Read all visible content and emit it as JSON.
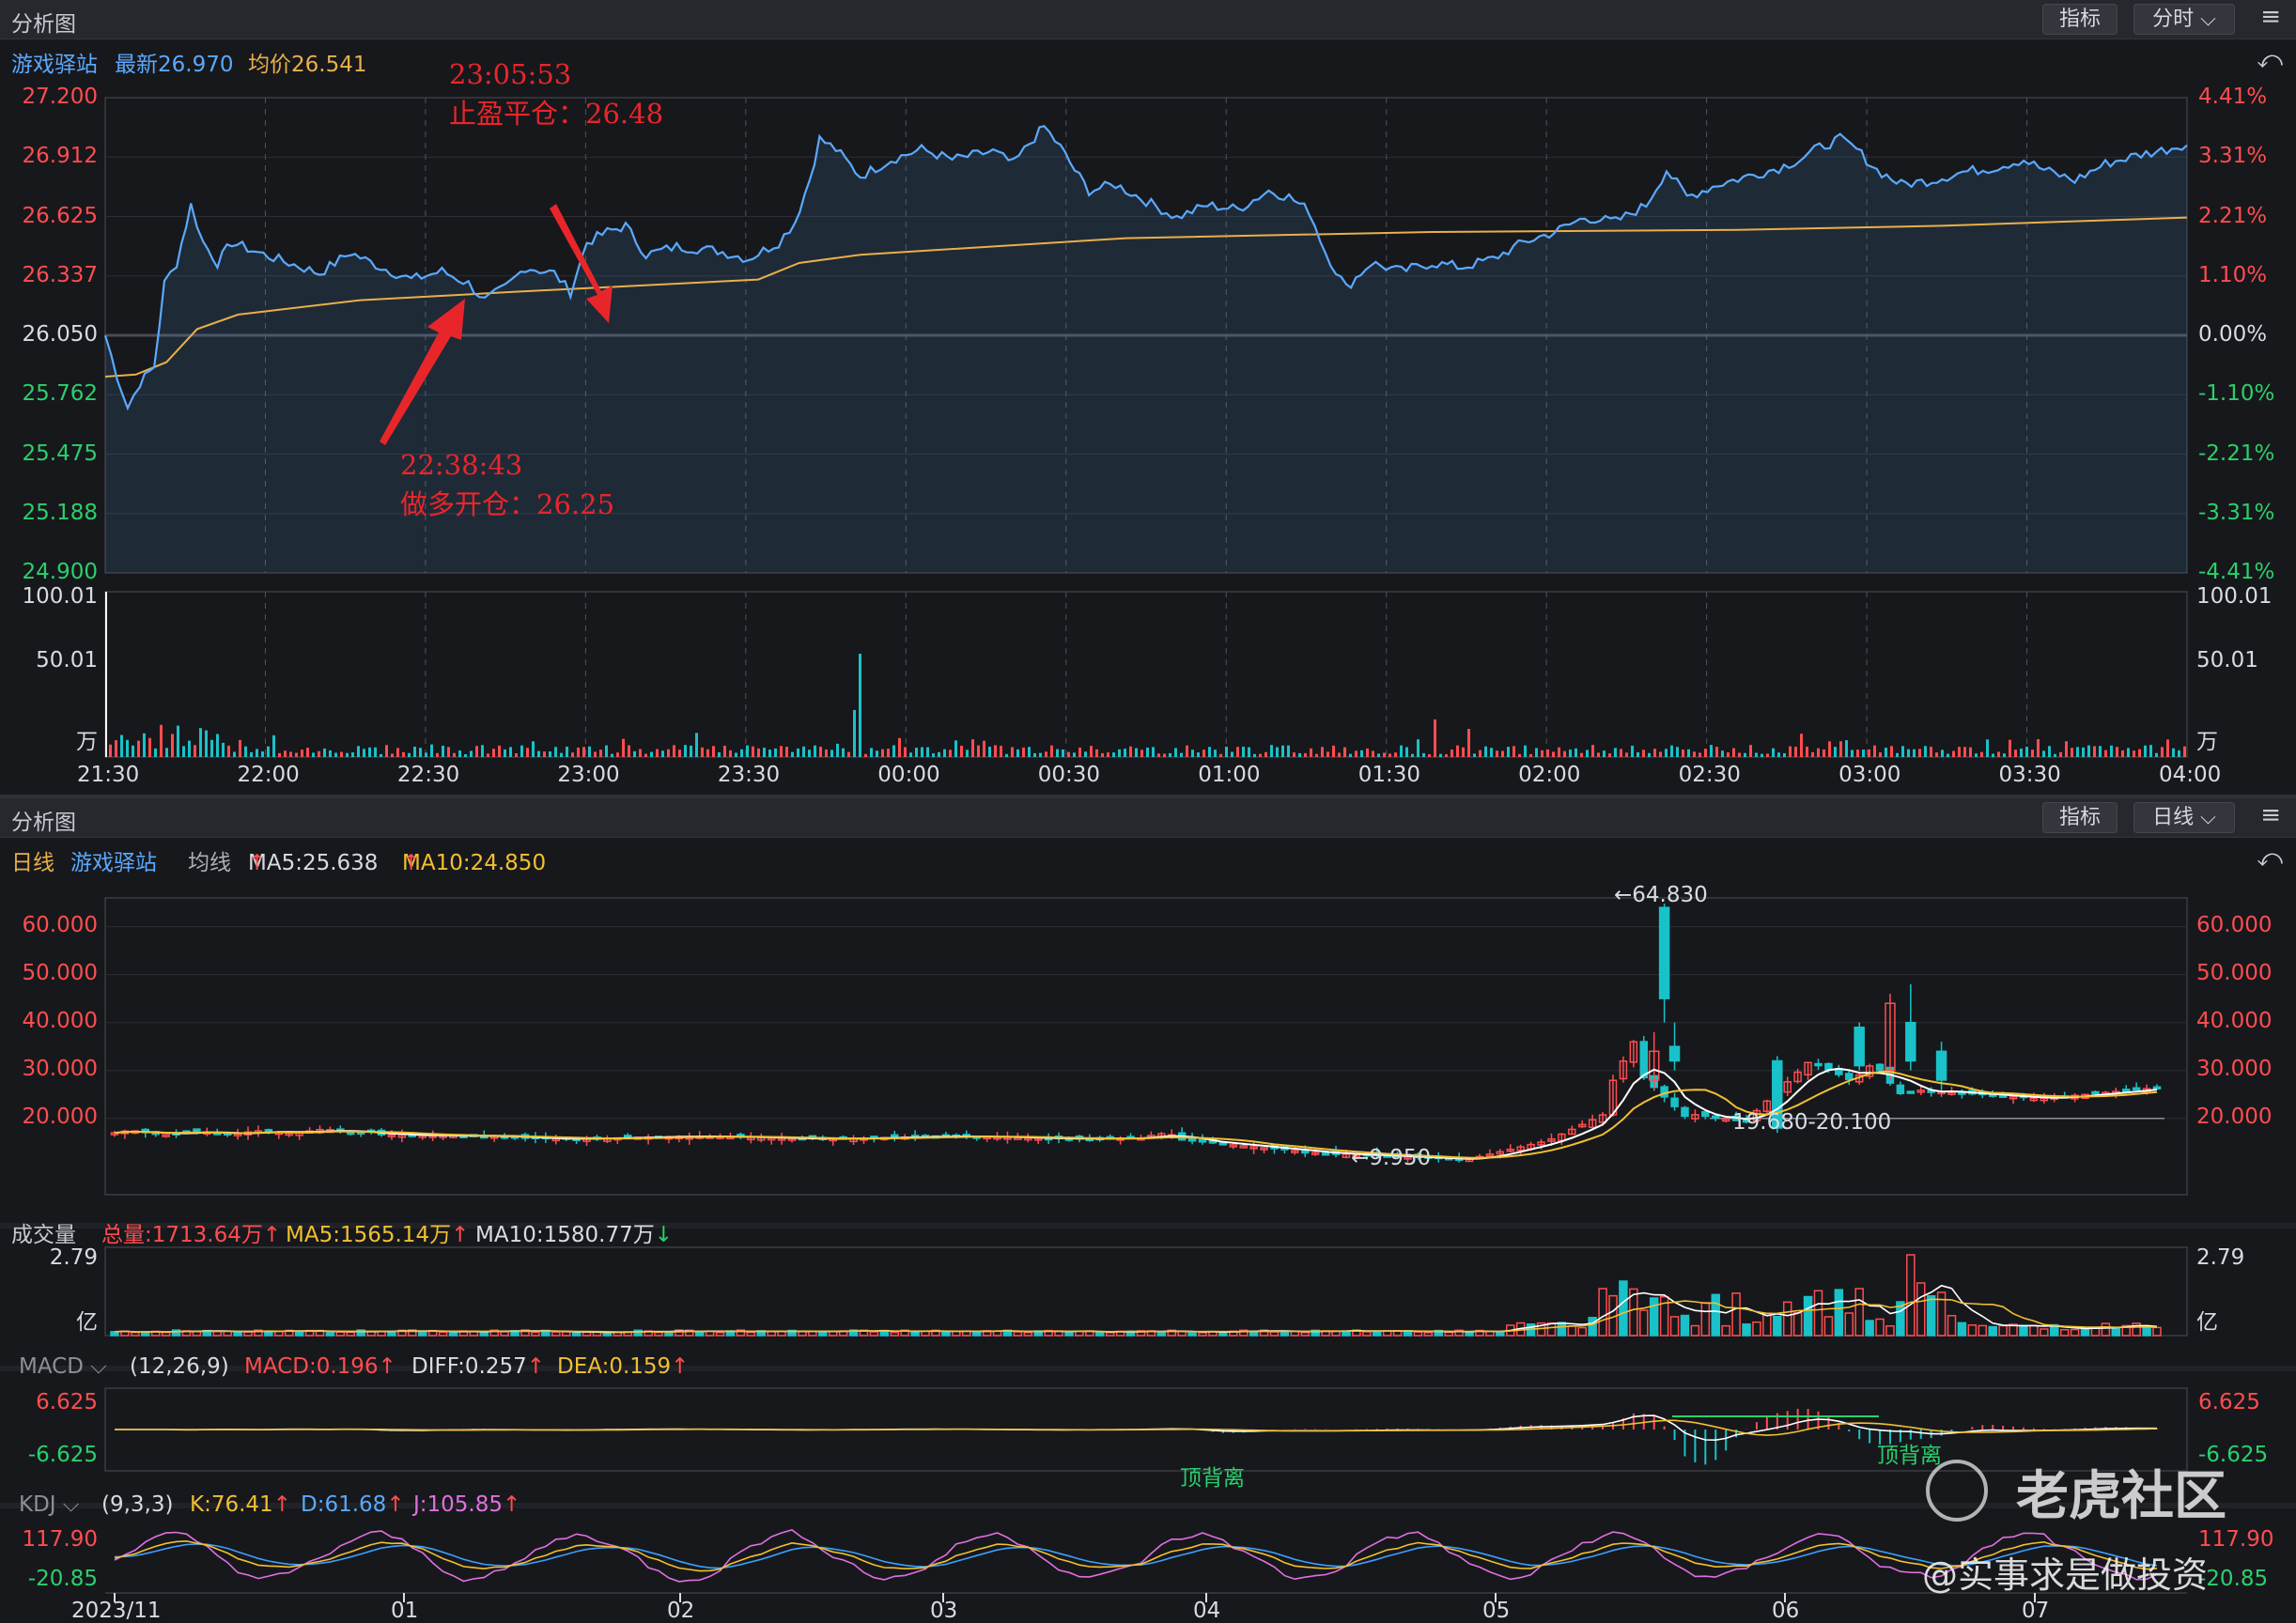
{
  "top": {
    "header": {
      "title": "分析图",
      "indicator_btn": "指标",
      "period_btn": "分时",
      "menu_icon": "hamburger-icon"
    },
    "info": {
      "name": "游戏驿站",
      "latest": "最新26.970",
      "avg": "均价26.541"
    },
    "price_axis_left": [
      "27.200",
      "26.912",
      "26.625",
      "26.337",
      "26.050",
      "25.762",
      "25.475",
      "25.188",
      "24.900"
    ],
    "pct_axis_right": [
      "4.41%",
      "3.31%",
      "2.21%",
      "1.10%",
      "0.00%",
      "-1.10%",
      "-2.21%",
      "-3.31%",
      "-4.41%"
    ],
    "volume_axis": [
      "100.01",
      "50.01",
      "万"
    ],
    "time_axis": [
      "21:30",
      "22:00",
      "22:30",
      "23:00",
      "23:30",
      "00:00",
      "00:30",
      "01:00",
      "01:30",
      "02:00",
      "02:30",
      "03:00",
      "03:30",
      "04:00"
    ],
    "annotations": {
      "exit_time": "23:05:53",
      "exit_text": "止盈平仓：26.48",
      "entry_time": "22:38:43",
      "entry_text": "做多开仓：26.25"
    }
  },
  "bottom": {
    "header": {
      "title": "分析图",
      "indicator_btn": "指标",
      "period_btn": "日线",
      "menu_icon": "hamburger-icon"
    },
    "info": {
      "period": "日线",
      "name": "游戏驿站",
      "ma_label": "均线",
      "ma5": "MA5:25.638",
      "ma10": "MA10:24.850"
    },
    "price_axis": [
      "60.000",
      "50.000",
      "40.000",
      "30.000",
      "20.000"
    ],
    "annotations": {
      "high": "←64.830",
      "low": "←9.950",
      "range": "19.680-20.100"
    },
    "volume": {
      "title": "成交量",
      "total": "总量:1713.64万",
      "ma5": "MA5:1565.14万",
      "ma10": "MA10:1580.77万",
      "axis_top": "2.79",
      "axis_unit": "亿"
    },
    "macd": {
      "title": "MACD",
      "params": "(12,26,9)",
      "macd": "MACD:0.196",
      "diff": "DIFF:0.257",
      "dea": "DEA:0.159",
      "axis_top": "6.625",
      "axis_bottom": "-6.625",
      "label1": "顶背离",
      "label2": "顶背离"
    },
    "kdj": {
      "title": "KDJ",
      "params": "(9,3,3)",
      "k": "K:76.41",
      "d": "D:61.68",
      "j": "J:105.85",
      "axis_top": "117.90",
      "axis_bottom": "-20.85"
    },
    "date_axis": [
      "2023/11",
      "01",
      "02",
      "03",
      "04",
      "05",
      "06",
      "07"
    ]
  },
  "watermark": {
    "brand": "老虎社区",
    "user": "@实事求是做投资"
  },
  "colors": {
    "up": "#ff4d4f",
    "down": "#19c2c8",
    "price_line": "#5aa9ff",
    "avg_line": "#e8b04a"
  }
}
